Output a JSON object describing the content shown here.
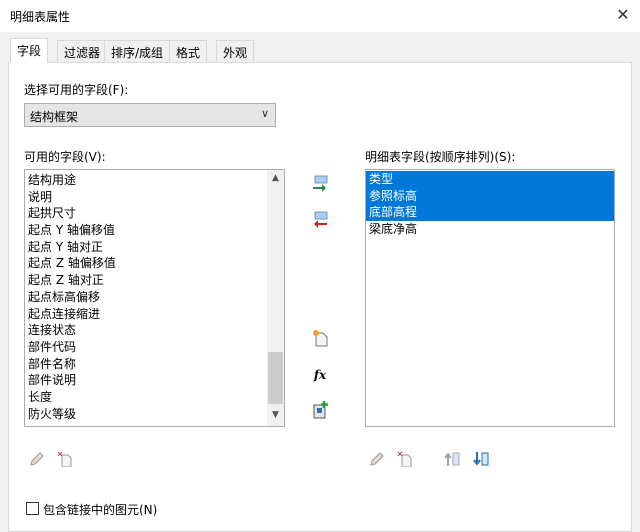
{
  "window": {
    "title": "明细表属性",
    "close": "✕"
  },
  "tabs": [
    "字段",
    "过滤器",
    "排序/成组",
    "格式",
    "外观"
  ],
  "select_label": "选择可用的字段(F):",
  "dropdown_value": "结构框架",
  "available_label": "可用的字段(V):",
  "available_fields": [
    "结构用途",
    "说明",
    "起拱尺寸",
    "起点 Y 轴偏移值",
    "起点 Y 轴对正",
    "起点 Z 轴偏移值",
    "起点 Z 轴对正",
    "起点标高偏移",
    "起点连接缩进",
    "连接状态",
    "部件代码",
    "部件名称",
    "部件说明",
    "长度",
    "防火等级"
  ],
  "scheduled_label": "明细表字段(按顺序排列)(S):",
  "scheduled_fields": [
    {
      "label": "类型",
      "selected": true
    },
    {
      "label": "参照标高",
      "selected": true
    },
    {
      "label": "底部高程",
      "selected": true
    },
    {
      "label": "梁底净高",
      "selected": false
    }
  ],
  "include_linked_label": "包含链接中的图元(N)",
  "colors": {
    "selection": "#0078d7"
  }
}
